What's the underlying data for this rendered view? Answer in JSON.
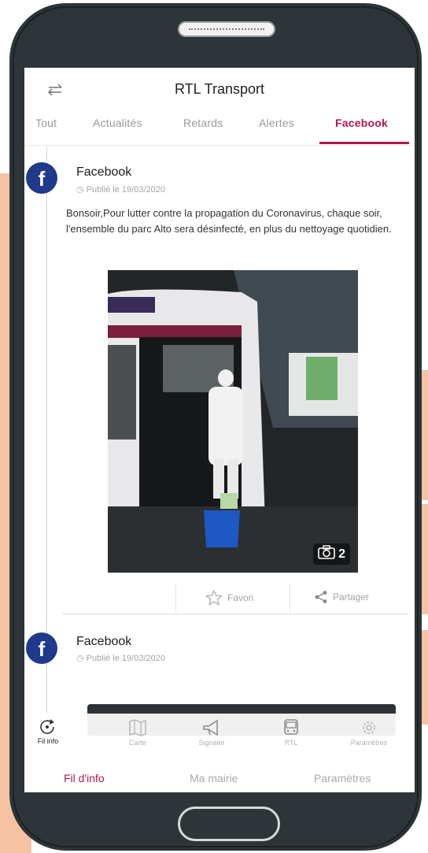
{
  "app": {
    "title": "RTL Transport"
  },
  "tabs": [
    {
      "label": "Tout",
      "active": false
    },
    {
      "label": "Actualités",
      "active": false
    },
    {
      "label": "Retards",
      "active": false
    },
    {
      "label": "Alertes",
      "active": false
    },
    {
      "label": "Facebook",
      "active": true
    }
  ],
  "posts": [
    {
      "source": "Facebook",
      "date": "Publié le 19/03/2020",
      "text": "Bonsoir,Pour lutter contre la propagation du Coronavirus, chaque soir, l'ensemble du parc Alto sera désinfecté, en plus du nettoyage quotidien.",
      "photo_count": "2",
      "favorite_label": "Favori",
      "share_label": "Partager"
    },
    {
      "source": "Facebook",
      "date": "Publié le 19/03/2020"
    }
  ],
  "bottom_nav": [
    {
      "label": "Fil info",
      "icon": "refresh-icon",
      "active": true
    },
    {
      "label": "Carte",
      "icon": "map-icon",
      "active": false
    },
    {
      "label": "Signaler",
      "icon": "megaphone-icon",
      "active": false
    },
    {
      "label": "RTL",
      "icon": "bus-icon",
      "active": false
    },
    {
      "label": "Paramètres",
      "icon": "gear-icon",
      "active": false
    }
  ],
  "lower_nav": [
    {
      "label": "Fil d'info",
      "active": true
    },
    {
      "label": "Ma mairie",
      "active": false
    },
    {
      "label": "Paramètres",
      "active": false
    }
  ],
  "colors": {
    "accent": "#b3184a",
    "facebook": "#1f3a8a",
    "hand": "#f6c2a2",
    "phone_body": "#2d3538"
  }
}
